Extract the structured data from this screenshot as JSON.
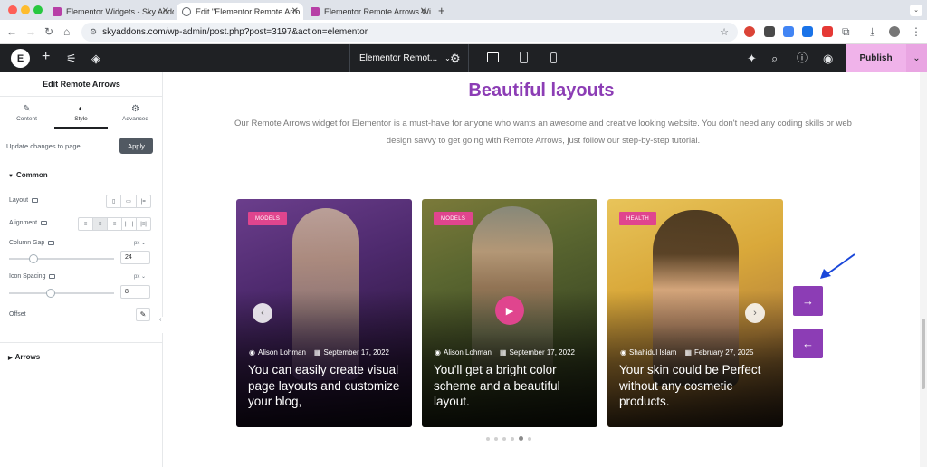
{
  "browser": {
    "tabs": [
      {
        "title": "Elementor Widgets - Sky Addo",
        "active": false
      },
      {
        "title": "Edit \"Elementor Remote Arro",
        "active": true
      },
      {
        "title": "Elementor Remote Arrows Wi",
        "active": false
      }
    ],
    "url": "skyaddons.com/wp-admin/post.php?post=3197&action=elementor"
  },
  "editor": {
    "document_title": "Elementor Remot...",
    "publish_label": "Publish"
  },
  "panel": {
    "title": "Edit Remote Arrows",
    "tabs": [
      {
        "label": "Content",
        "icon": "pencil-icon"
      },
      {
        "label": "Style",
        "icon": "half-circle-icon",
        "active": true
      },
      {
        "label": "Advanced",
        "icon": "gear-icon"
      }
    ],
    "update_text": "Update changes to page",
    "apply_label": "Apply",
    "common_section": "Common",
    "layout_label": "Layout",
    "alignment_label": "Alignment",
    "column_gap_label": "Column Gap",
    "column_gap_unit": "px",
    "column_gap_value": "24",
    "icon_spacing_label": "Icon Spacing",
    "icon_spacing_unit": "px",
    "icon_spacing_value": "8",
    "offset_label": "Offset",
    "arrows_section": "Arrows"
  },
  "page": {
    "heading": "Beautiful layouts",
    "description": "Our Remote Arrows widget for Elementor is a must-have for anyone who wants an awesome and creative looking website. You don't need any coding skills or web design savvy to get going with Remote Arrows, just follow our step-by-step tutorial.",
    "cards": [
      {
        "badge": "MODELS",
        "author": "Alison Lohman",
        "date": "September 17, 2022",
        "title": "You can easily create visual page layouts and customize your blog,"
      },
      {
        "badge": "MODELS",
        "author": "Alison Lohman",
        "date": "September 17, 2022",
        "title": "You'll get a bright color scheme and a beautiful layout."
      },
      {
        "badge": "HEALTH",
        "author": "Shahidul Islam",
        "date": "February 27, 2025",
        "title": "Your skin could be Perfect without any cosmetic products."
      }
    ],
    "next_arrow": "→",
    "prev_arrow": "←",
    "pagination_active_index": 4
  },
  "colors": {
    "accent": "#8c3db5",
    "badge": "#e0458e",
    "publish": "#f0b3ea",
    "editor_bar": "#1f2124"
  }
}
